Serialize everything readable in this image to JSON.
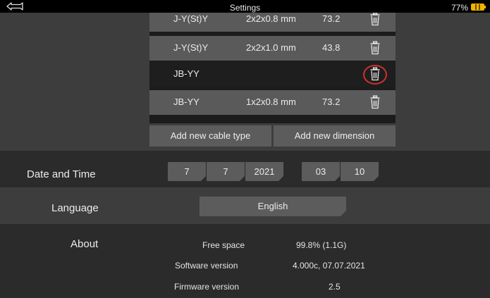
{
  "status_bar": {
    "title": "Settings",
    "battery": "77%"
  },
  "cables": [
    {
      "type": "J-Y(St)Y",
      "dimension": "2x2x0.8 mm",
      "value": "73.2"
    },
    {
      "type": "J-Y(St)Y",
      "dimension": "2x2x1.0 mm",
      "value": "43.8"
    },
    {
      "type": "JB-YY",
      "dimension": "",
      "value": ""
    },
    {
      "type": "JB-YY",
      "dimension": "1x2x0.8 mm",
      "value": "73.2"
    }
  ],
  "cable_actions": {
    "add_type": "Add new cable type",
    "add_dimension": "Add new dimension"
  },
  "date_time": {
    "label": "Date and Time",
    "day": "7",
    "month": "7",
    "year": "2021",
    "hour": "03",
    "minute": "10"
  },
  "language": {
    "label": "Language",
    "value": "English"
  },
  "about": {
    "label": "About",
    "free_space_label": "Free space",
    "free_space": "99.8% (1.1G)",
    "software_label": "Software version",
    "software": "4.000c, 07.07.2021",
    "firmware_label": "Firmware version",
    "firmware": "2.5"
  },
  "colors": {
    "accent_highlight": "#d0312d",
    "battery": "#f0b400"
  }
}
